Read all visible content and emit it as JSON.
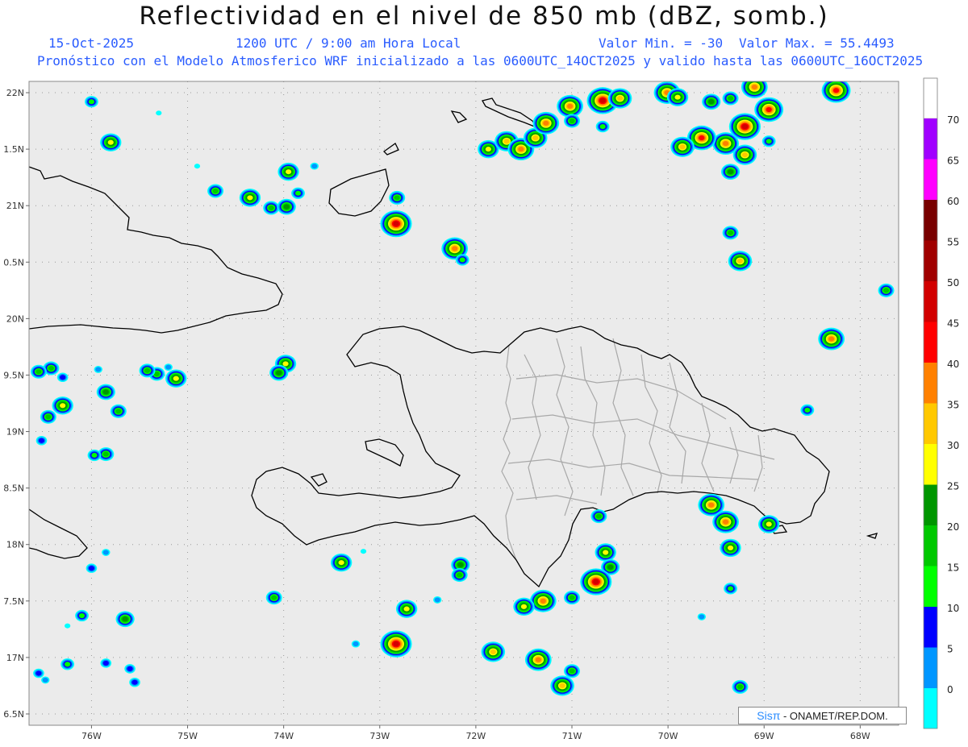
{
  "title": "Reflectividad en el nivel de 850 mb (dBZ, somb.)",
  "header": {
    "date": "15-Oct-2025",
    "time": "1200 UTC / 9:00 am Hora Local",
    "min_label": "Valor Min. = -30",
    "max_label": "Valor Max. = 55.4493",
    "forecast_line": "Pronóstico con el Modelo Atmosferico WRF inicializado a las 0600UTC_14OCT2025 y valido hasta las  0600UTC_16OCT2025"
  },
  "map": {
    "background_color": "#ebebeb",
    "coast_color": "#000000",
    "province_color": "#a8a8a8",
    "lon_range": [
      -76.65,
      -67.6
    ],
    "lat_range": [
      16.4,
      22.1
    ],
    "lon_ticks": [
      {
        "value": -76,
        "label": "76W"
      },
      {
        "value": -75,
        "label": "75W"
      },
      {
        "value": -74,
        "label": "74W"
      },
      {
        "value": -73,
        "label": "73W"
      },
      {
        "value": -72,
        "label": "72W"
      },
      {
        "value": -71,
        "label": "71W"
      },
      {
        "value": -70,
        "label": "70W"
      },
      {
        "value": -69,
        "label": "69W"
      },
      {
        "value": -68,
        "label": "68W"
      }
    ],
    "lat_ticks": [
      {
        "value": 22,
        "label": "22N"
      },
      {
        "value": 21.5,
        "label": "1.5N"
      },
      {
        "value": 21,
        "label": "21N"
      },
      {
        "value": 20.5,
        "label": "0.5N"
      },
      {
        "value": 20,
        "label": "20N"
      },
      {
        "value": 19.5,
        "label": "9.5N"
      },
      {
        "value": 19,
        "label": "19N"
      },
      {
        "value": 18.5,
        "label": "8.5N"
      },
      {
        "value": 18,
        "label": "18N"
      },
      {
        "value": 17.5,
        "label": "7.5N"
      },
      {
        "value": 17,
        "label": "17N"
      },
      {
        "value": 16.5,
        "label": "6.5N"
      }
    ]
  },
  "colorbar": {
    "levels": [
      {
        "value": 0,
        "label": "0",
        "color": "#00ffff"
      },
      {
        "value": 5,
        "label": "5",
        "color": "#0096ff"
      },
      {
        "value": 10,
        "label": "10",
        "color": "#0000ff"
      },
      {
        "value": 15,
        "label": "15",
        "color": "#00ff00"
      },
      {
        "value": 20,
        "label": "20",
        "color": "#00c800"
      },
      {
        "value": 25,
        "label": "25",
        "color": "#009600"
      },
      {
        "value": 30,
        "label": "30",
        "color": "#ffff00"
      },
      {
        "value": 35,
        "label": "35",
        "color": "#ffc800"
      },
      {
        "value": 40,
        "label": "40",
        "color": "#ff8000"
      },
      {
        "value": 45,
        "label": "45",
        "color": "#ff0000"
      },
      {
        "value": 50,
        "label": "50",
        "color": "#d20000"
      },
      {
        "value": 55,
        "label": "55",
        "color": "#a00000"
      },
      {
        "value": 60,
        "label": "60",
        "color": "#780000"
      },
      {
        "value": 65,
        "label": "65",
        "color": "#ff00ff"
      },
      {
        "value": 70,
        "label": "70",
        "color": "#a000ff"
      }
    ],
    "below_color": "#e8e8e8",
    "above_color": "#ffffff"
  },
  "cells": [
    {
      "lon": -76.0,
      "lat": 21.92,
      "intensity": 18
    },
    {
      "lon": -75.8,
      "lat": 21.56,
      "intensity": 32
    },
    {
      "lon": -75.3,
      "lat": 21.82,
      "intensity": 2
    },
    {
      "lon": -74.9,
      "lat": 21.35,
      "intensity": 3
    },
    {
      "lon": -74.71,
      "lat": 21.13,
      "intensity": 22
    },
    {
      "lon": -74.35,
      "lat": 21.07,
      "intensity": 30
    },
    {
      "lon": -74.13,
      "lat": 20.98,
      "intensity": 24
    },
    {
      "lon": -73.95,
      "lat": 21.3,
      "intensity": 30
    },
    {
      "lon": -73.85,
      "lat": 21.11,
      "intensity": 15
    },
    {
      "lon": -73.97,
      "lat": 20.99,
      "intensity": 26
    },
    {
      "lon": -73.68,
      "lat": 21.35,
      "intensity": 8
    },
    {
      "lon": -72.83,
      "lat": 20.84,
      "intensity": 52
    },
    {
      "lon": -72.82,
      "lat": 21.07,
      "intensity": 20
    },
    {
      "lon": -72.22,
      "lat": 20.62,
      "intensity": 42
    },
    {
      "lon": -72.14,
      "lat": 20.52,
      "intensity": 18
    },
    {
      "lon": -71.87,
      "lat": 21.5,
      "intensity": 30
    },
    {
      "lon": -71.68,
      "lat": 21.57,
      "intensity": 36
    },
    {
      "lon": -71.53,
      "lat": 21.5,
      "intensity": 40
    },
    {
      "lon": -71.38,
      "lat": 21.6,
      "intensity": 35
    },
    {
      "lon": -71.27,
      "lat": 21.73,
      "intensity": 44
    },
    {
      "lon": -71.02,
      "lat": 21.88,
      "intensity": 40
    },
    {
      "lon": -71.0,
      "lat": 21.75,
      "intensity": 22
    },
    {
      "lon": -70.68,
      "lat": 21.93,
      "intensity": 52
    },
    {
      "lon": -70.5,
      "lat": 21.95,
      "intensity": 35
    },
    {
      "lon": -70.68,
      "lat": 21.7,
      "intensity": 18
    },
    {
      "lon": -70.01,
      "lat": 22.0,
      "intensity": 40
    },
    {
      "lon": -69.9,
      "lat": 21.96,
      "intensity": 30
    },
    {
      "lon": -69.55,
      "lat": 21.92,
      "intensity": 26
    },
    {
      "lon": -69.35,
      "lat": 21.95,
      "intensity": 22
    },
    {
      "lon": -69.2,
      "lat": 21.7,
      "intensity": 52
    },
    {
      "lon": -69.4,
      "lat": 21.55,
      "intensity": 40
    },
    {
      "lon": -69.65,
      "lat": 21.6,
      "intensity": 45
    },
    {
      "lon": -69.85,
      "lat": 21.52,
      "intensity": 36
    },
    {
      "lon": -69.2,
      "lat": 21.45,
      "intensity": 35
    },
    {
      "lon": -69.35,
      "lat": 21.3,
      "intensity": 28
    },
    {
      "lon": -68.95,
      "lat": 21.85,
      "intensity": 48
    },
    {
      "lon": -68.95,
      "lat": 21.57,
      "intensity": 15
    },
    {
      "lon": -69.1,
      "lat": 22.05,
      "intensity": 40
    },
    {
      "lon": -68.25,
      "lat": 22.02,
      "intensity": 46
    },
    {
      "lon": -69.35,
      "lat": 20.76,
      "intensity": 24
    },
    {
      "lon": -69.25,
      "lat": 20.51,
      "intensity": 38
    },
    {
      "lon": -67.73,
      "lat": 20.25,
      "intensity": 20
    },
    {
      "lon": -68.3,
      "lat": 19.82,
      "intensity": 42
    },
    {
      "lon": -69.55,
      "lat": 18.35,
      "intensity": 42
    },
    {
      "lon": -69.4,
      "lat": 18.2,
      "intensity": 44
    },
    {
      "lon": -68.95,
      "lat": 18.18,
      "intensity": 32
    },
    {
      "lon": -69.35,
      "lat": 17.97,
      "intensity": 30
    },
    {
      "lon": -69.35,
      "lat": 17.61,
      "intensity": 18
    },
    {
      "lon": -69.65,
      "lat": 17.36,
      "intensity": 8
    },
    {
      "lon": -69.25,
      "lat": 16.74,
      "intensity": 20
    },
    {
      "lon": -68.55,
      "lat": 19.19,
      "intensity": 18
    },
    {
      "lon": -70.72,
      "lat": 18.25,
      "intensity": 24
    },
    {
      "lon": -70.65,
      "lat": 17.93,
      "intensity": 30
    },
    {
      "lon": -70.6,
      "lat": 17.8,
      "intensity": 28
    },
    {
      "lon": -70.75,
      "lat": 17.67,
      "intensity": 52
    },
    {
      "lon": -71.3,
      "lat": 17.5,
      "intensity": 44
    },
    {
      "lon": -71.5,
      "lat": 17.45,
      "intensity": 30
    },
    {
      "lon": -71.0,
      "lat": 17.53,
      "intensity": 24
    },
    {
      "lon": -71.1,
      "lat": 16.75,
      "intensity": 36
    },
    {
      "lon": -71.0,
      "lat": 16.88,
      "intensity": 22
    },
    {
      "lon": -71.35,
      "lat": 16.98,
      "intensity": 40
    },
    {
      "lon": -71.82,
      "lat": 17.05,
      "intensity": 38
    },
    {
      "lon": -72.16,
      "lat": 17.82,
      "intensity": 26
    },
    {
      "lon": -72.17,
      "lat": 17.73,
      "intensity": 20
    },
    {
      "lon": -72.4,
      "lat": 17.51,
      "intensity": 8
    },
    {
      "lon": -72.72,
      "lat": 17.43,
      "intensity": 34
    },
    {
      "lon": -72.83,
      "lat": 17.12,
      "intensity": 52
    },
    {
      "lon": -73.25,
      "lat": 17.12,
      "intensity": 6
    },
    {
      "lon": -73.4,
      "lat": 17.84,
      "intensity": 34
    },
    {
      "lon": -74.1,
      "lat": 17.53,
      "intensity": 22
    },
    {
      "lon": -73.98,
      "lat": 19.6,
      "intensity": 30
    },
    {
      "lon": -74.05,
      "lat": 19.52,
      "intensity": 28
    },
    {
      "lon": -75.12,
      "lat": 19.47,
      "intensity": 32
    },
    {
      "lon": -75.32,
      "lat": 19.51,
      "intensity": 24
    },
    {
      "lon": -75.42,
      "lat": 19.54,
      "intensity": 20
    },
    {
      "lon": -75.2,
      "lat": 19.57,
      "intensity": 6
    },
    {
      "lon": -75.72,
      "lat": 19.18,
      "intensity": 22
    },
    {
      "lon": -75.85,
      "lat": 19.35,
      "intensity": 26
    },
    {
      "lon": -75.93,
      "lat": 19.55,
      "intensity": 6
    },
    {
      "lon": -76.3,
      "lat": 19.48,
      "intensity": 10
    },
    {
      "lon": -76.42,
      "lat": 19.56,
      "intensity": 24
    },
    {
      "lon": -76.55,
      "lat": 19.53,
      "intensity": 20
    },
    {
      "lon": -76.3,
      "lat": 19.23,
      "intensity": 30
    },
    {
      "lon": -76.45,
      "lat": 19.13,
      "intensity": 20
    },
    {
      "lon": -76.52,
      "lat": 18.92,
      "intensity": 12
    },
    {
      "lon": -75.85,
      "lat": 18.8,
      "intensity": 20
    },
    {
      "lon": -75.97,
      "lat": 18.79,
      "intensity": 16
    },
    {
      "lon": -75.85,
      "lat": 17.93,
      "intensity": 6
    },
    {
      "lon": -76.0,
      "lat": 17.79,
      "intensity": 14
    },
    {
      "lon": -76.1,
      "lat": 17.37,
      "intensity": 16
    },
    {
      "lon": -75.65,
      "lat": 17.34,
      "intensity": 26
    },
    {
      "lon": -76.25,
      "lat": 17.28,
      "intensity": 4
    },
    {
      "lon": -76.25,
      "lat": 16.94,
      "intensity": 18
    },
    {
      "lon": -75.85,
      "lat": 16.95,
      "intensity": 10
    },
    {
      "lon": -76.55,
      "lat": 16.86,
      "intensity": 14
    },
    {
      "lon": -76.48,
      "lat": 16.8,
      "intensity": 8
    },
    {
      "lon": -75.6,
      "lat": 16.9,
      "intensity": 12
    },
    {
      "lon": -75.55,
      "lat": 16.78,
      "intensity": 14
    },
    {
      "lon": -73.17,
      "lat": 17.94,
      "intensity": 4
    }
  ],
  "footer": {
    "brand": "Sisπ",
    "credit": " - ONAMET/REP.DOM."
  }
}
